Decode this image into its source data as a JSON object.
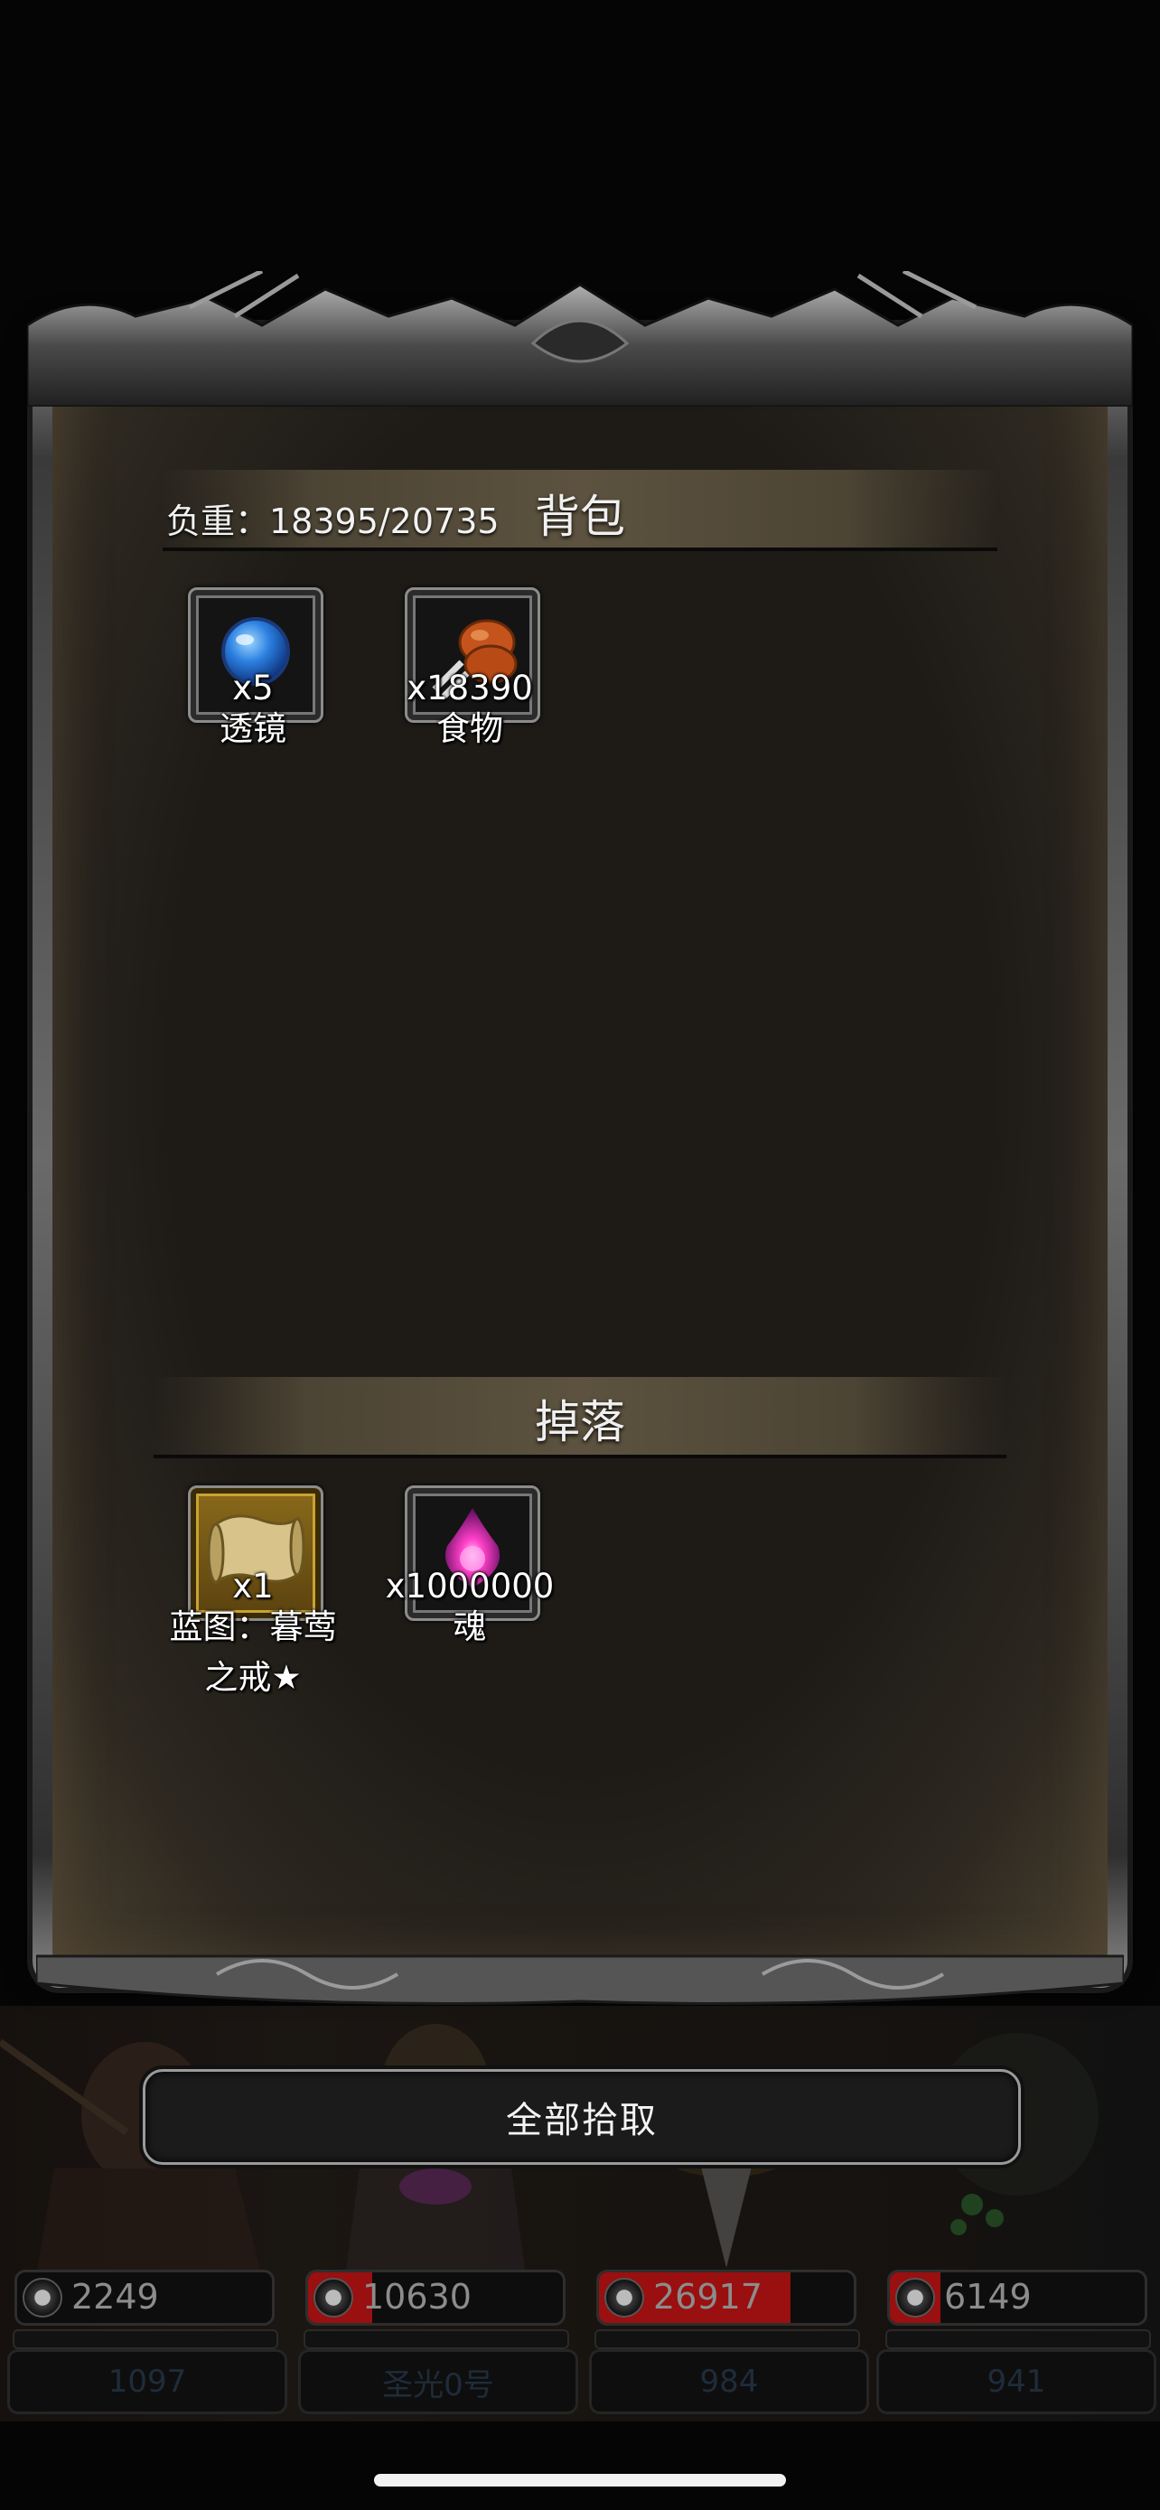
{
  "bag": {
    "load_text": "负重：18395/20735",
    "title": "背包",
    "items": [
      {
        "qty": "x5",
        "name": "透镜",
        "icon": "lens-icon"
      },
      {
        "qty": "x18390",
        "name": "食物",
        "icon": "food-icon"
      }
    ]
  },
  "drop": {
    "title": "掉落",
    "items": [
      {
        "qty": "x1",
        "name_line1": "蓝图：暮莺",
        "name_line2": "之戒★",
        "icon": "blueprint-scroll-icon"
      },
      {
        "qty": "x1000000",
        "name": "魂",
        "icon": "soul-icon"
      }
    ]
  },
  "actions": {
    "pickup_all_label": "全部拾取"
  },
  "party": [
    {
      "hp": "2249",
      "hp_fraction": 0.0,
      "name": "1097"
    },
    {
      "hp": "10630",
      "hp_fraction": 0.25,
      "name": "圣光0号"
    },
    {
      "hp": "26917",
      "hp_fraction": 0.75,
      "name": "984"
    },
    {
      "hp": "6149",
      "hp_fraction": 0.2,
      "name": "941"
    }
  ],
  "colors": {
    "hp_fill": "#9a0f0f",
    "panel_bg": "#1e1b17",
    "gold_slot": "#c9a233"
  }
}
